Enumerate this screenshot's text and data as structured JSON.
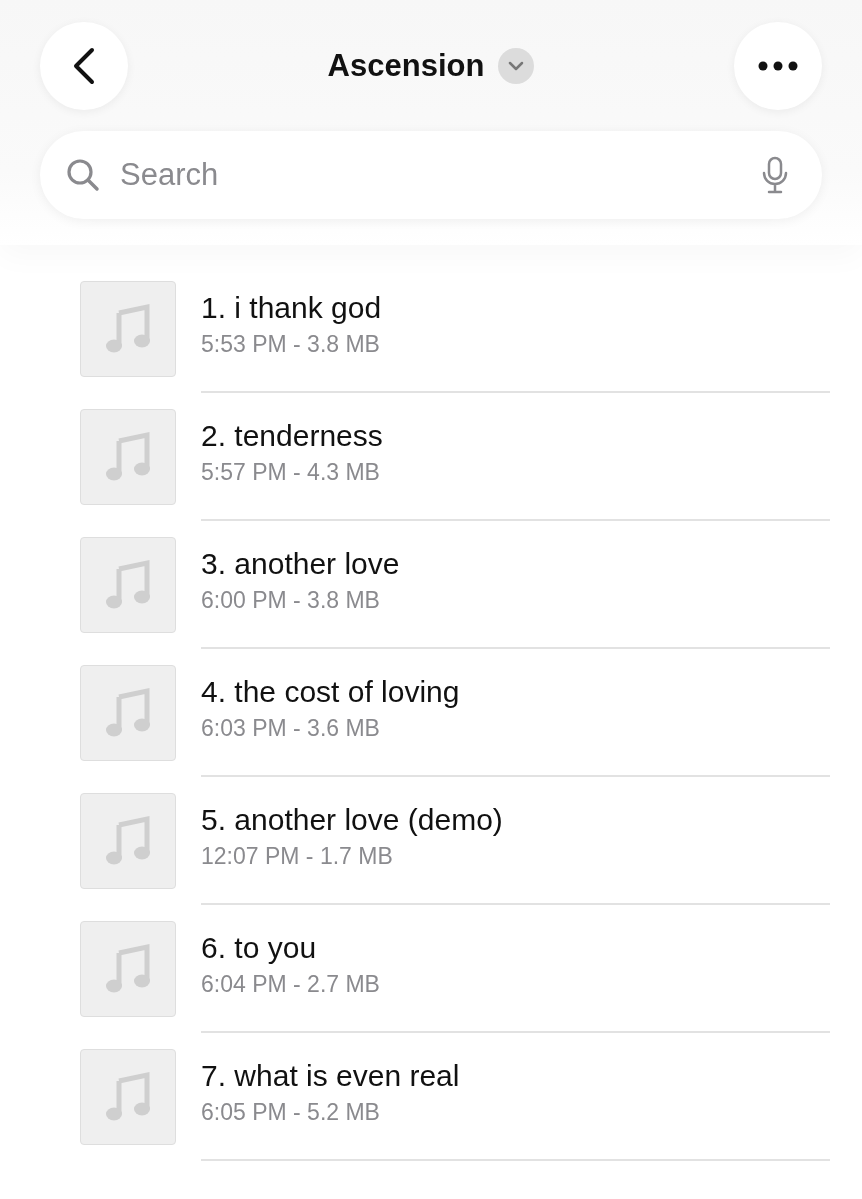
{
  "header": {
    "title": "Ascension"
  },
  "search": {
    "placeholder": "Search"
  },
  "files": [
    {
      "name": "1. i thank god",
      "meta": "5:53 PM - 3.8 MB"
    },
    {
      "name": "2. tenderness",
      "meta": "5:57 PM - 4.3 MB"
    },
    {
      "name": "3. another love",
      "meta": "6:00 PM - 3.8 MB"
    },
    {
      "name": "4. the cost of loving",
      "meta": "6:03 PM - 3.6 MB"
    },
    {
      "name": "5. another love (demo)",
      "meta": "12:07 PM - 1.7 MB"
    },
    {
      "name": "6. to you",
      "meta": "6:04 PM - 2.7 MB"
    },
    {
      "name": "7. what is even real",
      "meta": "6:05 PM - 5.2 MB"
    }
  ]
}
